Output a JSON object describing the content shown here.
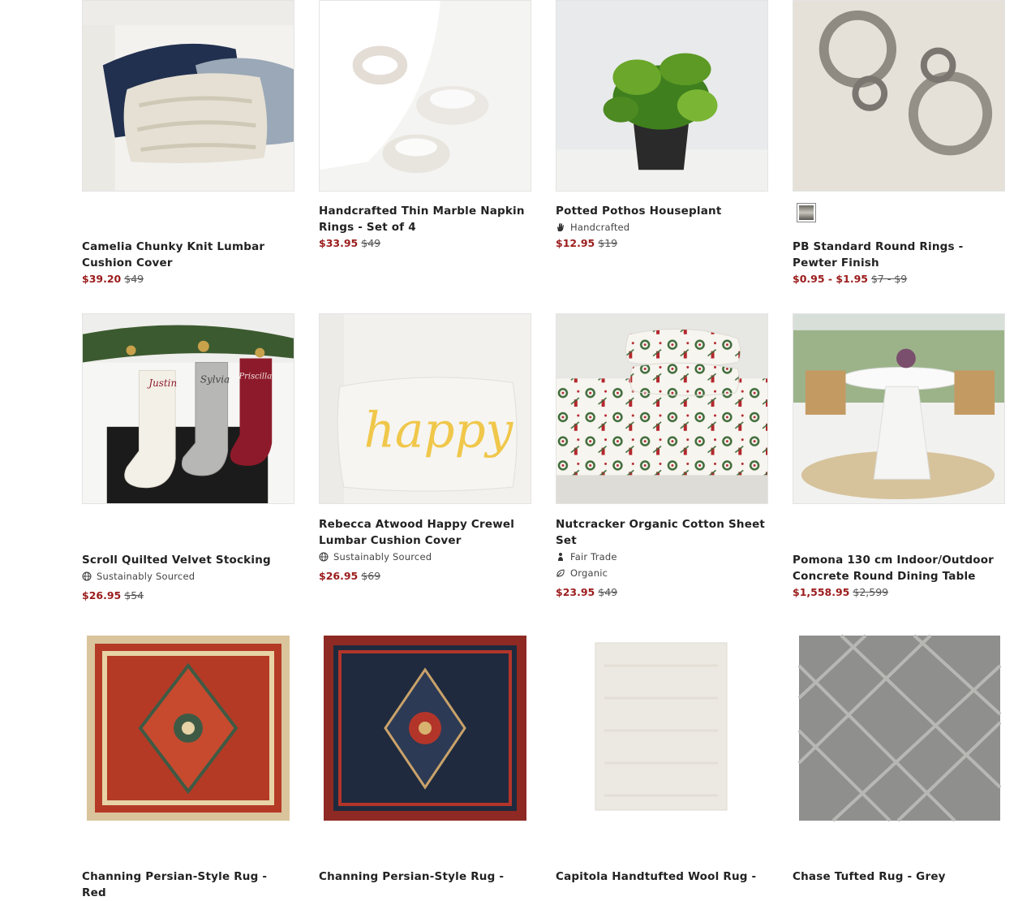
{
  "products": [
    {
      "title": "Camelia Chunky Knit Lumbar Cushion Cover",
      "sale": "$39.20",
      "orig": "$49"
    },
    {
      "title": "Handcrafted Thin Marble Napkin Rings - Set of 4",
      "sale": "$33.95",
      "orig": "$49"
    },
    {
      "title": "Potted Pothos Houseplant",
      "badges": [
        "Handcrafted"
      ],
      "sale": "$12.95",
      "orig": "$19"
    },
    {
      "title": "PB Standard Round Rings - Pewter Finish",
      "sale": "$0.95 - $1.95",
      "orig": "$7 - $9"
    },
    {
      "title": "Scroll Quilted Velvet Stocking",
      "badges": [
        "Sustainably Sourced"
      ],
      "sale": "$26.95",
      "orig": "$54"
    },
    {
      "title": "Rebecca Atwood Happy Crewel Lumbar Cushion Cover",
      "badges": [
        "Sustainably Sourced"
      ],
      "sale": "$26.95",
      "orig": "$69"
    },
    {
      "title": "Nutcracker Organic Cotton Sheet Set",
      "badges": [
        "Fair Trade",
        "Organic"
      ],
      "sale": "$23.95",
      "orig": "$49"
    },
    {
      "title": "Pomona 130 cm Indoor/Outdoor Concrete Round Dining Table",
      "sale": "$1,558.95",
      "orig": "$2,599"
    },
    {
      "title": "Channing Persian-Style Rug - Red"
    },
    {
      "title": "Channing Persian-Style Rug -"
    },
    {
      "title": "Capitola Handtufted Wool Rug -"
    },
    {
      "title": "Chase Tufted Rug - Grey"
    }
  ],
  "image_text": {
    "stocking_names": [
      "Justin",
      "Sylvia",
      "Priscilla"
    ],
    "pillow_word": "happy"
  },
  "colors": {
    "sale": "#9b1c1c",
    "title": "#222222"
  }
}
